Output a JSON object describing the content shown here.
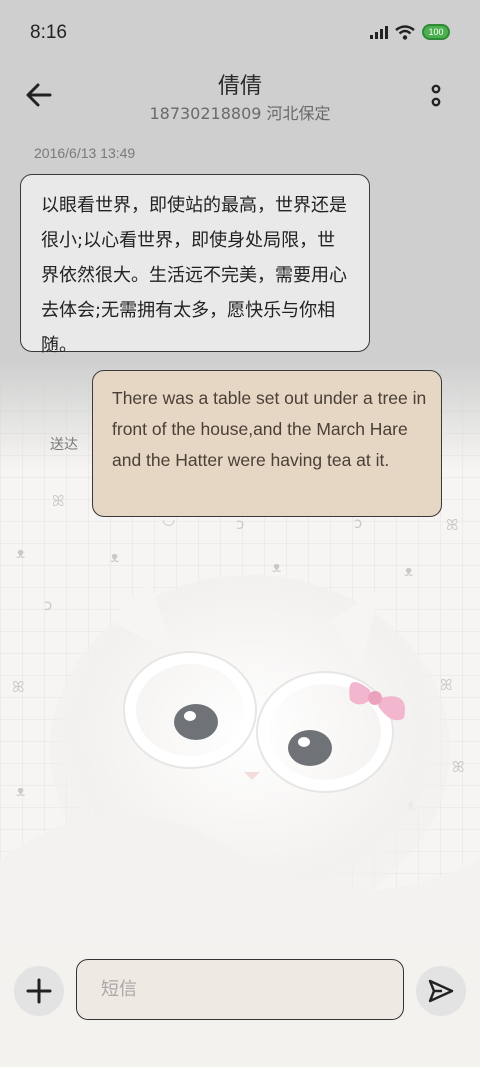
{
  "status_bar": {
    "time": "8:16",
    "battery": "100",
    "icons": [
      "signal-icon",
      "wifi-icon",
      "battery-icon"
    ]
  },
  "header": {
    "contact_name": "倩倩",
    "contact_subtitle": "18730218809 河北保定",
    "icons": [
      "back-arrow-icon",
      "more-vertical-icon"
    ]
  },
  "messages": {
    "timestamp": "2016/6/13 13:49",
    "incoming_text": "以眼看世界，即使站的最高，世界还是很小;以心看世界，即使身处局限，世界依然很大。生活远不完美，需要用心去体会;无需拥有太多，愿快乐与你相随。",
    "outgoing_text": "There was a table set out under a tree in front of the house,and the March Hare and the Hatter were having tea at it.",
    "outgoing_status": "送达"
  },
  "composer": {
    "placeholder": "短信",
    "icons": [
      "plus-icon",
      "send-icon"
    ]
  },
  "colors": {
    "incoming_bubble": "#e9e9e9",
    "outgoing_bubble": "#e6d7c5",
    "border": "#3a3a3a",
    "battery": "#4caf50"
  }
}
